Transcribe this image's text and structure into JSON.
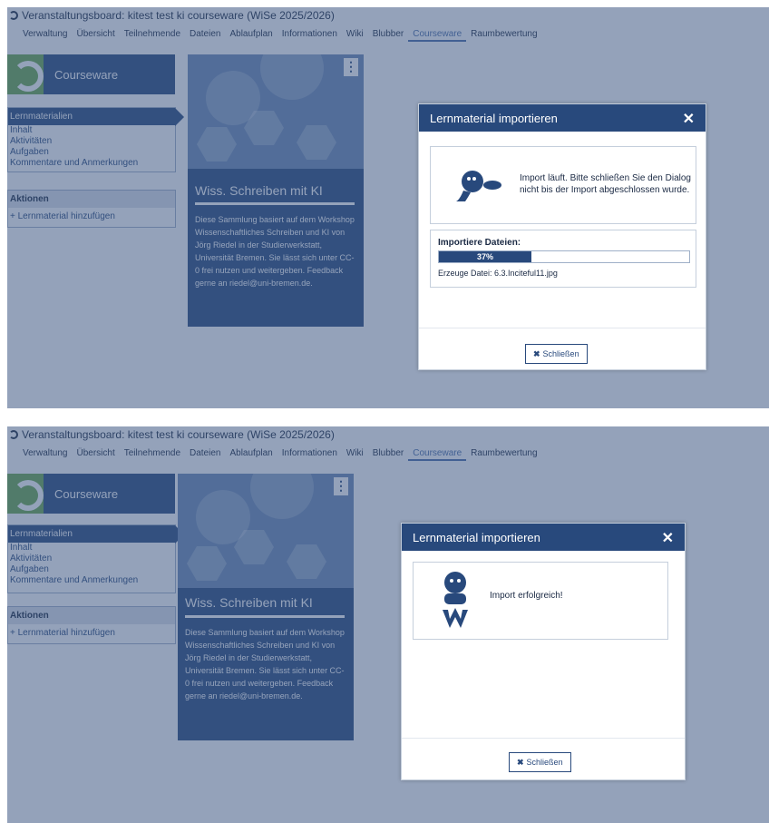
{
  "course_title": "Veranstaltungsboard: kitest test ki courseware (WiSe 2025/2026)",
  "nav_tabs": [
    "Verwaltung",
    "Übersicht",
    "Teilnehmende",
    "Dateien",
    "Ablaufplan",
    "Informationen",
    "Wiki",
    "Blubber",
    "Courseware",
    "Raumbewertung"
  ],
  "active_tab": "Courseware",
  "sidebar": {
    "banner_label": "Courseware",
    "section_head": "Lernmaterialien",
    "items": [
      "Inhalt",
      "Aktivitäten",
      "Aufgaben",
      "Kommentare und Anmerkungen"
    ],
    "actions_head": "Aktionen",
    "add_material": "Lernmaterial hinzufügen"
  },
  "card": {
    "title": "Wiss. Schreiben mit KI",
    "description": "Diese Sammlung basiert auf dem Workshop Wissenschaftliches Schreiben und KI von Jörg Riedel in der Studierwerkstatt, Universität Bremen. Sie lässt sich unter CC-0 frei nutzen und weitergeben. Feedback gerne an riedel@uni-bremen.de.",
    "menu_glyph": "⋮"
  },
  "dialog_running": {
    "title": "Lernmaterial importieren",
    "close_glyph": "✕",
    "message": "Import läuft. Bitte schließen Sie den Dialog nicht bis der Import abgeschlossen wurde.",
    "progress_label": "Importiere Dateien:",
    "progress_percent": 37,
    "progress_text": "37%",
    "current_file": "Erzeuge Datei: 6.3.Inciteful11.jpg",
    "close_button": "Schließen",
    "close_button_icon": "✖"
  },
  "dialog_done": {
    "title": "Lernmaterial importieren",
    "close_glyph": "✕",
    "message": "Import erfolgreich!",
    "close_button": "Schließen",
    "close_button_icon": "✖"
  },
  "colors": {
    "brand_blue": "#28497c",
    "accent_green": "#6aa84f",
    "overlay": "#3c5582"
  },
  "icons": {
    "mascot_working": "mascot-working-icon",
    "mascot_success": "mascot-success-icon"
  }
}
